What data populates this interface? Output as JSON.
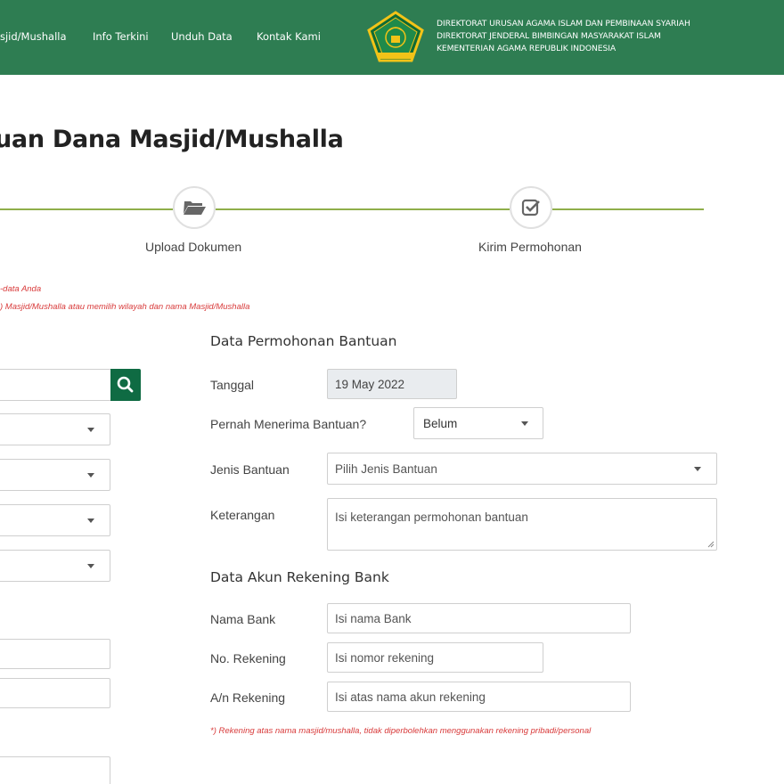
{
  "header": {
    "nav": [
      "sjid/Mushalla",
      "Info Terkini",
      "Unduh Data",
      "Kontak Kami"
    ],
    "org_lines": [
      "DIREKTORAT URUSAN AGAMA ISLAM DAN PEMBINAAN SYARIAH",
      "DIREKTORAT JENDERAL BIMBINGAN MASYARAKAT ISLAM",
      "KEMENTERIAN AGAMA REPUBLIK INDONESIA"
    ]
  },
  "page_title": "uan Dana Masjid/Mushalla",
  "stepper": [
    {
      "label": "Upload Dokumen",
      "icon": "folder-open-icon"
    },
    {
      "label": "Kirim Permohonan",
      "icon": "check-square-icon"
    }
  ],
  "notes": [
    "-data Anda",
    ") Masjid/Mushalla atau memilih wilayah dan nama Masjid/Mushalla"
  ],
  "form": {
    "section_permohonan": "Data Permohonan Bantuan",
    "tanggal_label": "Tanggal",
    "tanggal_value": "19 May 2022",
    "pernah_label": "Pernah Menerima Bantuan?",
    "pernah_value": "Belum",
    "jenis_label": "Jenis Bantuan",
    "jenis_value": "Pilih Jenis Bantuan",
    "keterangan_label": "Keterangan",
    "keterangan_placeholder": "Isi keterangan permohonan bantuan",
    "section_bank": "Data Akun Rekening Bank",
    "nama_bank_label": "Nama Bank",
    "nama_bank_placeholder": "Isi nama Bank",
    "no_rek_label": "No. Rekening",
    "no_rek_placeholder": "Isi nomor rekening",
    "an_rek_label": "A/n Rekening",
    "an_rek_placeholder": "Isi atas nama akun rekening",
    "bank_note": "*) Rekening atas nama masjid/mushalla, tidak diperbolehkan menggunakan rekening pribadi/personal"
  },
  "colors": {
    "header_green": "#2e7d52",
    "step_line": "#8fae4a",
    "button_green": "#0f6b43",
    "note_red": "#d83a3a"
  }
}
